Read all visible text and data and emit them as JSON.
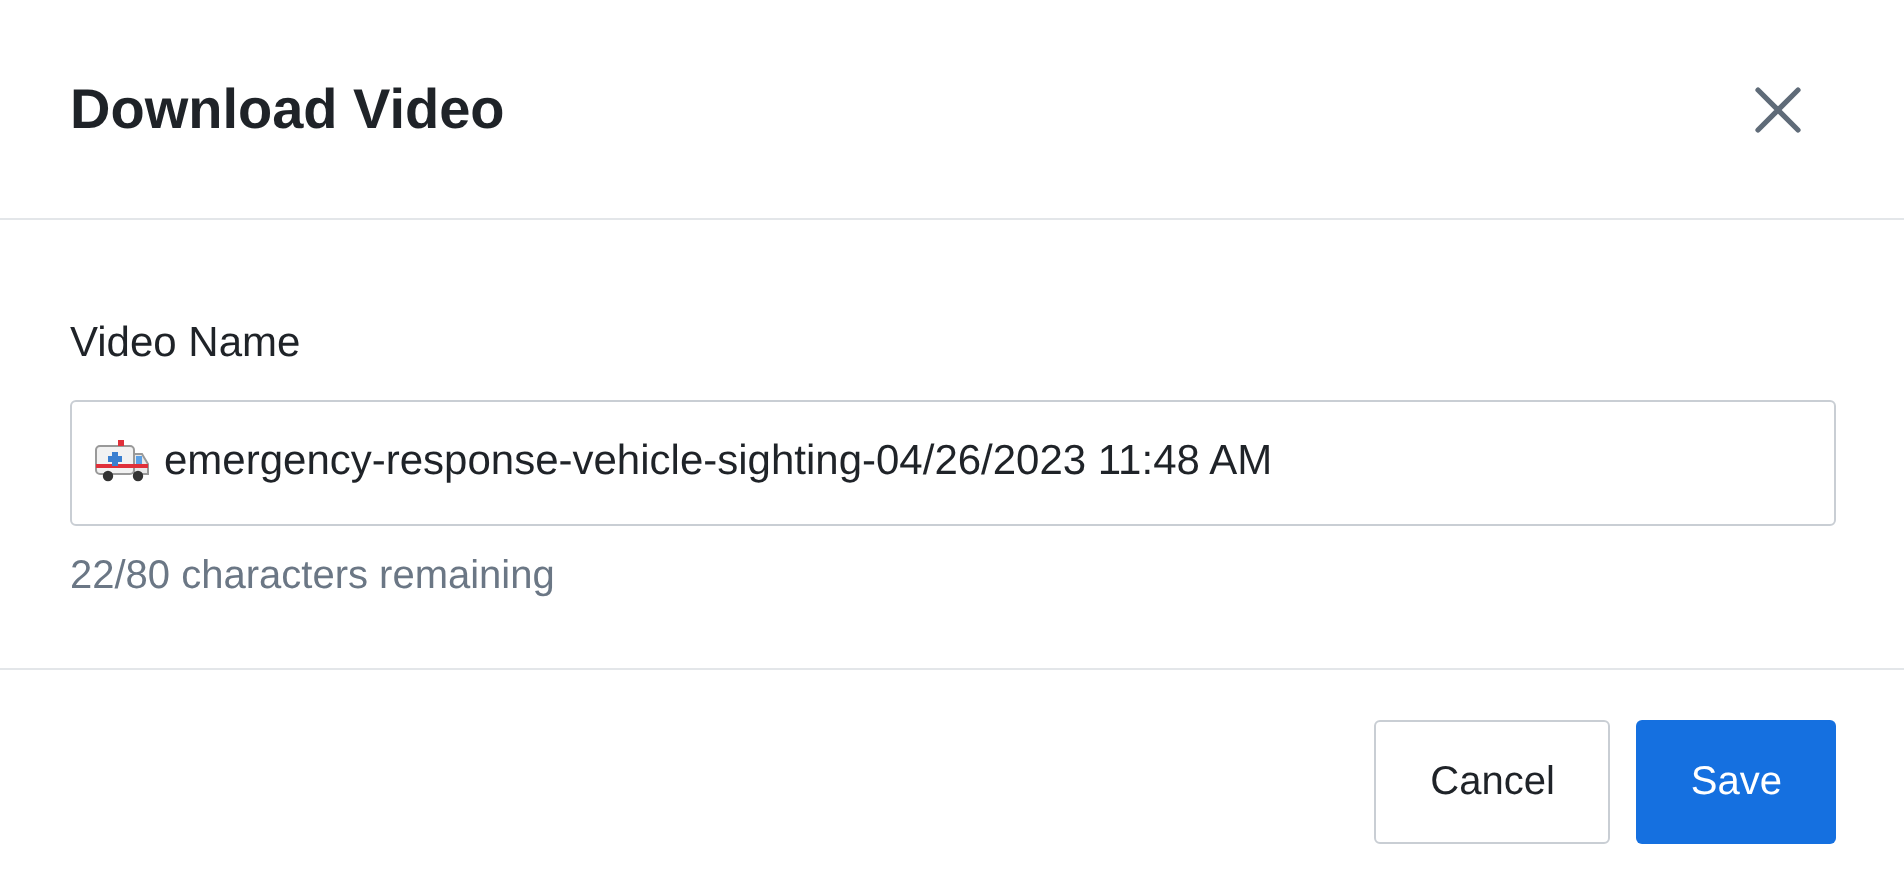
{
  "dialog": {
    "title": "Download Video"
  },
  "field": {
    "label": "Video Name",
    "value": "emergency-response-vehicle-sighting-04/26/2023 11:48 AM",
    "helper": "22/80 characters remaining"
  },
  "buttons": [
    {
      "label": "Cancel",
      "kind": "secondary"
    },
    {
      "label": "Save",
      "kind": "primary"
    }
  ]
}
